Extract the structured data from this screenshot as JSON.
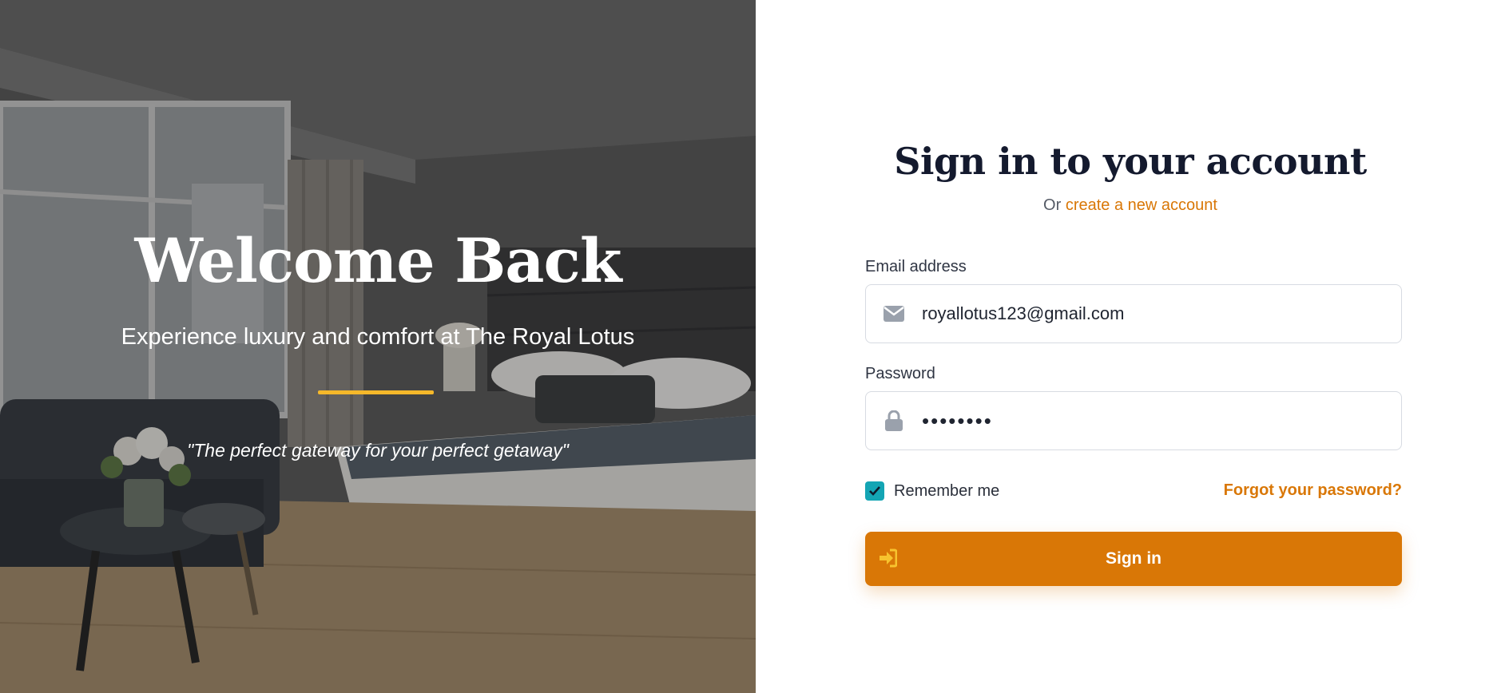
{
  "hero": {
    "heading": "Welcome Back",
    "subheading": "Experience luxury and comfort at The Royal Lotus",
    "quote": "\"The perfect gateway for your perfect getaway\"",
    "accent_color": "#f5b82a"
  },
  "form": {
    "title": "Sign in to your account",
    "alt_prefix": "Or",
    "alt_link": "create a new account",
    "email_label": "Email address",
    "email_value": "royallotus123@gmail.com",
    "password_label": "Password",
    "password_value": "••••••••",
    "remember_label": "Remember me",
    "remember_checked": true,
    "forgot_link": "Forgot your password?",
    "submit_label": "Sign in",
    "accent_color": "#d97706",
    "icons": [
      "envelope-icon",
      "lock-icon",
      "check-icon",
      "sign-in-icon"
    ]
  }
}
